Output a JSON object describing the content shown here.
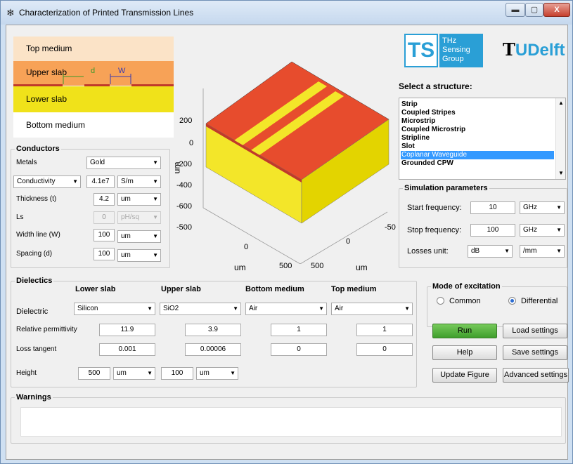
{
  "window": {
    "title": "Characterization of Printed Transmission Lines",
    "min": "▬",
    "max": "▢",
    "close": "X"
  },
  "layers": {
    "top": "Top medium",
    "upper": "Upper slab",
    "d": "d",
    "w": "W",
    "lower": "Lower slab",
    "bottom": "Bottom medium",
    "colors": {
      "top": "#fbe3c7",
      "upper": "#f7a257",
      "lower": "#f0e21a",
      "bottom": "#ffffff",
      "metal": "#c0392b"
    }
  },
  "logos": {
    "ts": "TS",
    "thz_line1": "THz",
    "thz_line2": "Sensing",
    "thz_line3": "Group",
    "tudelft_t": "T",
    "tudelft_rest": "UDelft"
  },
  "plot": {
    "yticks": [
      "200",
      "0",
      "-200",
      "-400",
      "-600",
      "-800",
      "-500"
    ],
    "ylabel": "um",
    "x_left_ticks": [
      "0",
      "500"
    ],
    "x_left_label": "um",
    "x_right_ticks": [
      "-50",
      "0",
      "500"
    ],
    "x_right_label": "um"
  },
  "structure": {
    "title": "Select a structure:",
    "items": [
      "Strip",
      "Coupled Stripes",
      "Microstrip",
      "Coupled Microstrip",
      "Stripline",
      "Slot",
      "Coplanar Waveguide",
      "Grounded CPW"
    ],
    "selected": "Coplanar Waveguide"
  },
  "conductors": {
    "title": "Conductors",
    "metals_label": "Metals",
    "metals_value": "Gold",
    "conductivity_label": "Conductivity",
    "conductivity_value": "4.1e7",
    "conductivity_unit": "S/m",
    "thickness_label": "Thickness (t)",
    "thickness_value": "4.2",
    "thickness_unit": "um",
    "ls_label": "Ls",
    "ls_value": "0",
    "ls_unit": "pH/sq",
    "width_label": "Width line (W)",
    "width_value": "100",
    "width_unit": "um",
    "spacing_label": "Spacing (d)",
    "spacing_value": "100",
    "spacing_unit": "um"
  },
  "simulation": {
    "title": "Simulation parameters",
    "start_label": "Start frequency:",
    "start_value": "10",
    "start_unit": "GHz",
    "stop_label": "Stop frequency:",
    "stop_value": "100",
    "stop_unit": "GHz",
    "losses_label": "Losses unit:",
    "losses_value": "dB",
    "losses_per": "/mm"
  },
  "dielectrics": {
    "title": "Dielectics",
    "headers": [
      "Lower slab",
      "Upper slab",
      "Bottom medium",
      "Top medium"
    ],
    "dielectric_label": "Dielectric",
    "dielectric_values": [
      "Silicon",
      "SiO2",
      "Air",
      "Air"
    ],
    "permittivity_label": "Relative permittivity",
    "permittivity_values": [
      "11.9",
      "3.9",
      "1",
      "1"
    ],
    "loss_label": "Loss tangent",
    "loss_values": [
      "0.001",
      "0.00006",
      "0",
      "0"
    ],
    "height_label": "Height",
    "height_lower": "500",
    "height_lower_unit": "um",
    "height_upper": "100",
    "height_upper_unit": "um"
  },
  "excitation": {
    "title": "Mode of excitation",
    "common": "Common",
    "differential": "Differential",
    "selected": "differential"
  },
  "buttons": {
    "run": "Run",
    "load": "Load settings",
    "help": "Help",
    "save": "Save settings",
    "update": "Update Figure",
    "advanced": "Advanced settings"
  },
  "warnings": {
    "title": "Warnings",
    "text": ""
  }
}
